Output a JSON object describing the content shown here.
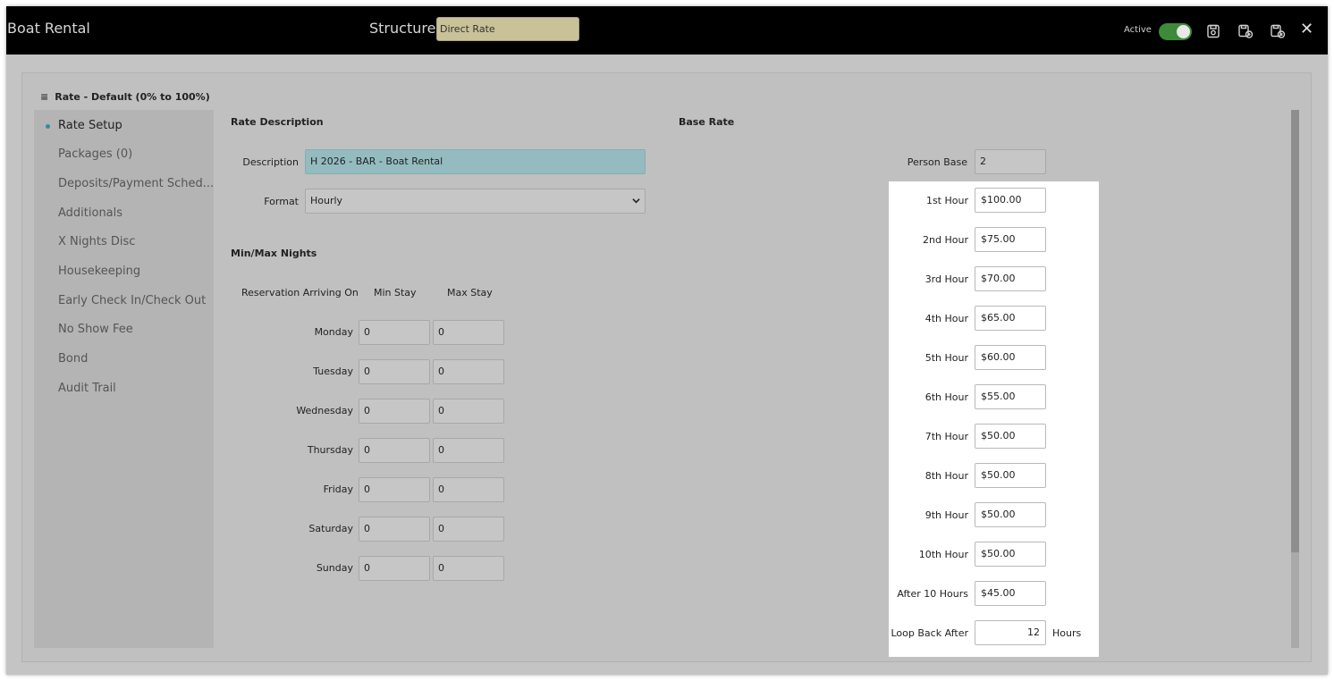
{
  "header": {
    "title": "Boat Rental",
    "structure_label": "Structure",
    "structure_value": "Direct Rate",
    "active_label": "Active",
    "active_on": true,
    "icons": [
      "save-icon",
      "save-copy-icon",
      "save-close-icon",
      "close-icon"
    ],
    "close_glyph": "✕"
  },
  "rate": {
    "title": "Rate - Default (0% to 100%)"
  },
  "sidebar": {
    "items": [
      {
        "label": "Rate Setup",
        "active": true
      },
      {
        "label": "Packages (0)"
      },
      {
        "label": "Deposits/Payment Sched..."
      },
      {
        "label": "Additionals"
      },
      {
        "label": "X Nights Disc"
      },
      {
        "label": "Housekeeping"
      },
      {
        "label": "Early Check In/Check Out"
      },
      {
        "label": "No Show Fee"
      },
      {
        "label": "Bond"
      },
      {
        "label": "Audit Trail"
      }
    ]
  },
  "rate_description": {
    "heading": "Rate Description",
    "description_label": "Description",
    "description_value": "H 2026 - BAR - Boat Rental",
    "format_label": "Format",
    "format_value": "Hourly"
  },
  "min_max": {
    "heading": "Min/Max Nights",
    "col_arriving": "Reservation Arriving On",
    "col_min": "Min Stay",
    "col_max": "Max Stay",
    "rows": [
      {
        "day": "Monday",
        "min": "0",
        "max": "0"
      },
      {
        "day": "Tuesday",
        "min": "0",
        "max": "0"
      },
      {
        "day": "Wednesday",
        "min": "0",
        "max": "0"
      },
      {
        "day": "Thursday",
        "min": "0",
        "max": "0"
      },
      {
        "day": "Friday",
        "min": "0",
        "max": "0"
      },
      {
        "day": "Saturday",
        "min": "0",
        "max": "0"
      },
      {
        "day": "Sunday",
        "min": "0",
        "max": "0"
      }
    ]
  },
  "base_rate": {
    "heading": "Base Rate",
    "person_base_label": "Person Base",
    "person_base_value": "2",
    "hours": [
      {
        "label": "1st Hour",
        "value": "$100.00"
      },
      {
        "label": "2nd Hour",
        "value": "$75.00"
      },
      {
        "label": "3rd Hour",
        "value": "$70.00"
      },
      {
        "label": "4th Hour",
        "value": "$65.00"
      },
      {
        "label": "5th Hour",
        "value": "$60.00"
      },
      {
        "label": "6th Hour",
        "value": "$55.00"
      },
      {
        "label": "7th Hour",
        "value": "$50.00"
      },
      {
        "label": "8th Hour",
        "value": "$50.00"
      },
      {
        "label": "9th Hour",
        "value": "$50.00"
      },
      {
        "label": "10th Hour",
        "value": "$50.00"
      },
      {
        "label": "After 10 Hours",
        "value": "$45.00"
      }
    ],
    "loop_label": "Loop Back After",
    "loop_value": "12",
    "loop_unit": "Hours"
  },
  "colors": {
    "toggle_on": "#3d8a3a",
    "structure_field": "#c9c198",
    "description_field": "#94bcc0",
    "active_dot": "#2b8ea6"
  }
}
